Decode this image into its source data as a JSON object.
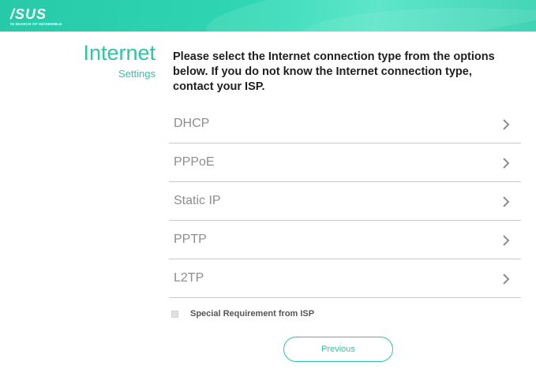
{
  "header": {
    "logo_text": "/SUS",
    "logo_tagline": "IN SEARCH OF INCREDIBLE"
  },
  "page": {
    "title": "Internet",
    "subtitle": "Settings",
    "instruction": "Please select the Internet connection type from the options below. If you do not know the Internet connection type, contact your ISP."
  },
  "options": [
    {
      "label": "DHCP",
      "icon": "chevron-right-icon"
    },
    {
      "label": "PPPoE",
      "icon": "chevron-right-icon"
    },
    {
      "label": "Static IP",
      "icon": "chevron-right-icon"
    },
    {
      "label": "PPTP",
      "icon": "chevron-right-icon"
    },
    {
      "label": "L2TP",
      "icon": "chevron-right-icon"
    }
  ],
  "special_requirement": {
    "label": "Special Requirement from ISP",
    "checked": false
  },
  "buttons": {
    "previous_label": "Previous"
  },
  "colors": {
    "accent": "#2fc4a3",
    "header_start": "#27c9a8",
    "header_end": "#4ce3c4",
    "divider": "#c9c9c9",
    "option_text": "#8d8d8d"
  }
}
